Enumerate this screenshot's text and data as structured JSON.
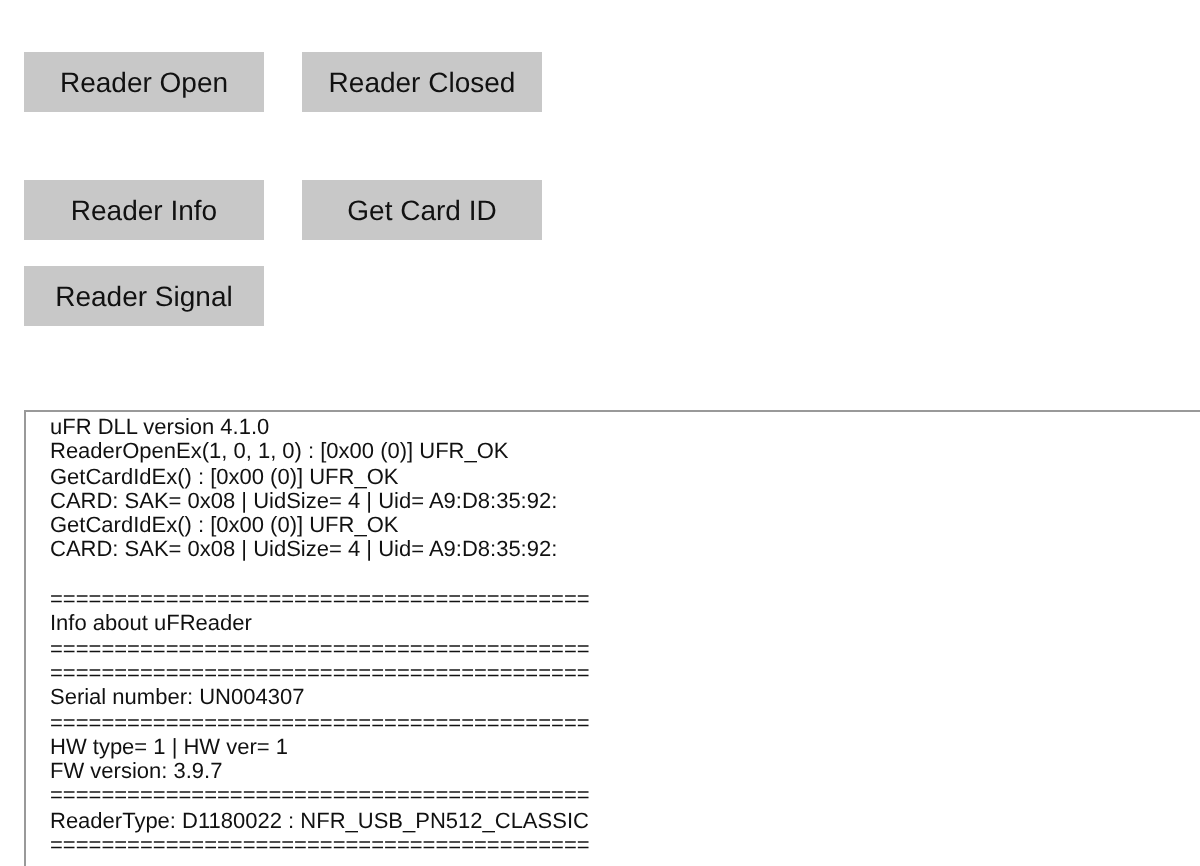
{
  "button_rows": [
    [
      "Reader Open",
      "Reader Closed"
    ],
    [
      "Reader Info",
      "Get Card ID"
    ],
    [
      "Reader Signal"
    ]
  ],
  "log": {
    "blocks": [
      [
        "uFR DLL version 4.1.0",
        "ReaderOpenEx(1, 0, 1, 0) : [0x00 (0)] UFR_OK",
        "GetCardIdEx() : [0x00 (0)] UFR_OK",
        "CARD: SAK= 0x08 | UidSize= 4 | Uid= A9:D8:35:92:",
        "GetCardIdEx() : [0x00 (0)] UFR_OK",
        "CARD: SAK= 0x08 | UidSize= 4 | Uid= A9:D8:35:92:"
      ],
      [
        "==========================================",
        "Info about uFReader",
        "==========================================",
        "==========================================",
        "Serial number: UN004307",
        "==========================================",
        "HW type= 1 | HW ver= 1",
        "FW version: 3.9.7",
        "==========================================",
        "ReaderType: D1180022 : NFR_USB_PN512_CLASSIC",
        "=========================================="
      ]
    ]
  }
}
